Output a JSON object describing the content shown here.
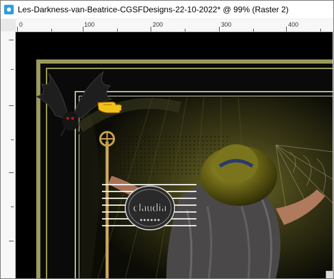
{
  "window": {
    "title": "Les-Darkness-van-Beatrice-CGSFDesigns-22-10-2022* @  99% (Raster 2)",
    "app_icon": "paint-shop-pro-icon"
  },
  "ruler": {
    "top_labels": [
      "0",
      "100",
      "200",
      "300",
      "400"
    ]
  },
  "artwork": {
    "watermark_text": "claudia",
    "watermark_subtext": "◆ ◆ ◆ ◆ ◆ ◆",
    "pointer_icon": "pointing-hand-icon",
    "bat_icon": "bat-icon",
    "frame_color": "#9a9a5a",
    "accent_color": "#6b6a20"
  }
}
